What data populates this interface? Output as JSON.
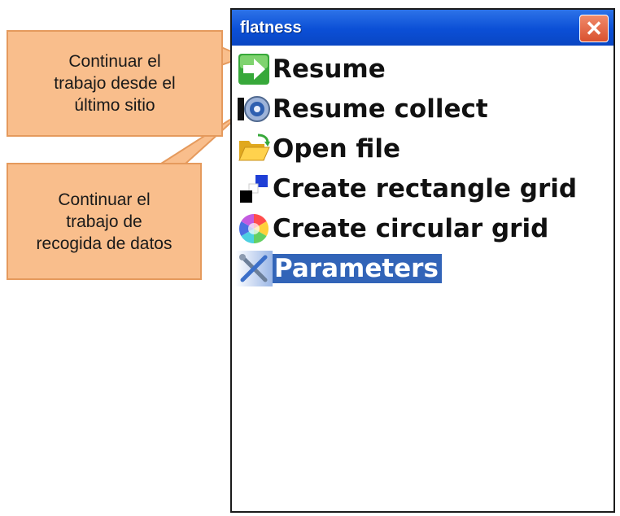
{
  "window": {
    "title": "flatness",
    "close_glyph": "✕"
  },
  "menu": {
    "items": [
      {
        "label": "Resume",
        "icon": "resume-arrow-icon"
      },
      {
        "label": "Resume collect",
        "icon": "resume-collect-icon"
      },
      {
        "label": "Open file",
        "icon": "folder-open-icon"
      },
      {
        "label": "Create rectangle grid",
        "icon": "rectangle-grid-icon"
      },
      {
        "label": "Create circular grid",
        "icon": "circular-grid-icon"
      },
      {
        "label": "Parameters",
        "icon": "tools-icon",
        "selected": true
      }
    ]
  },
  "annotations": {
    "callout_1": [
      "Continuar el",
      "trabajo desde el",
      "último sitio"
    ],
    "callout_2": [
      "Continuar el",
      "trabajo de",
      "recogida de datos"
    ]
  },
  "colors": {
    "titlebar": "#0b4fd6",
    "selection": "#3264b8",
    "callout_fill": "#f9be8c",
    "callout_border": "#e59a5d"
  }
}
